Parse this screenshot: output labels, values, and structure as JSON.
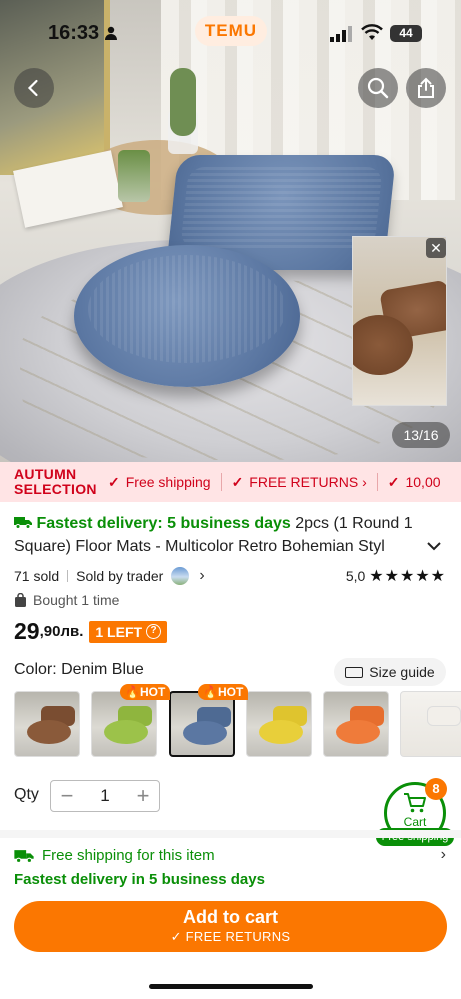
{
  "status": {
    "time": "16:33",
    "battery": "44"
  },
  "brand": "TEMU",
  "gallery": {
    "counter": "13/16"
  },
  "promo": {
    "badge_line1": "AUTUMN",
    "badge_line2": "SELECTION",
    "items": [
      "Free shipping",
      "FREE RETURNS ›",
      "10,00"
    ]
  },
  "product": {
    "delivery_label": "Fastest delivery: 5 business days",
    "title": " 2pcs (1 Round 1 Square) Floor Mats - Multicolor Retro Bohemian Styl",
    "sold": "71 sold",
    "seller": "Sold by trader",
    "rating": "5,0",
    "stars": "★★★★★",
    "bought": "Bought 1 time",
    "price_main": "29",
    "price_sub": ",90лв.",
    "stock_badge": "1 LEFT"
  },
  "options": {
    "color_label": "Color: Denim Blue",
    "size_guide": "Size guide",
    "hot_label": "HOT",
    "swatches": [
      {
        "name": "brown",
        "color": "#8a5a3a",
        "hot": false
      },
      {
        "name": "green",
        "color": "#9cc24a",
        "hot": true
      },
      {
        "name": "denim-blue",
        "color": "#5b77a2",
        "hot": true,
        "selected": true
      },
      {
        "name": "yellow",
        "color": "#e8cf3a",
        "hot": false
      },
      {
        "name": "orange",
        "color": "#ef7b3a",
        "hot": false
      },
      {
        "name": "white",
        "color": "#eeeae4",
        "hot": false
      }
    ]
  },
  "quantity": {
    "label": "Qty",
    "value": "1",
    "minus": "−",
    "plus": "+"
  },
  "cart": {
    "label": "Cart",
    "count": "8",
    "free_shipping": "Free shipping"
  },
  "shipping": {
    "line1": "Free shipping for this item",
    "line2": "Fastest delivery in 5 business days"
  },
  "cta": {
    "label": "Add to cart",
    "sub": "✓ FREE RETURNS"
  },
  "colors": {
    "accent": "#fb7701",
    "green": "#0a8f08",
    "promo_red": "#d0021b",
    "promo_bg": "#ffe4e5"
  }
}
